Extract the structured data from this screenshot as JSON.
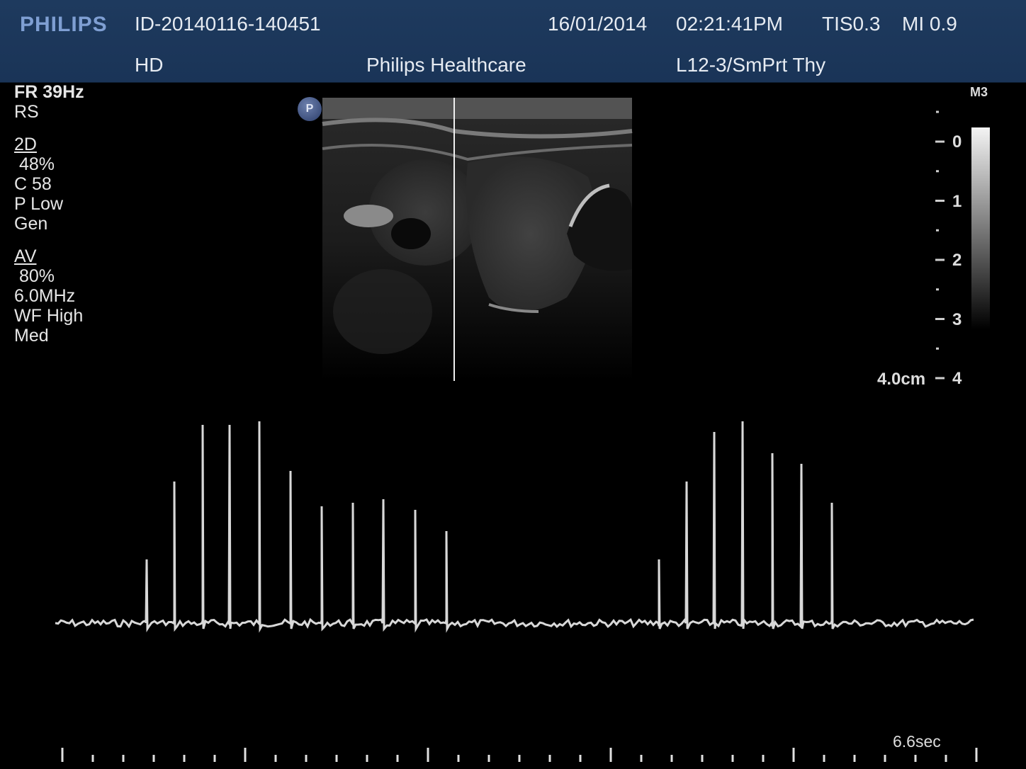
{
  "header": {
    "logo": "PHILIPS",
    "patient_id": "ID-20140116-140451",
    "date": "16/01/2014",
    "time": "02:21:41PM",
    "tis": "TIS0.3",
    "mi": "MI 0.9",
    "mode": "HD",
    "institution": "Philips Healthcare",
    "probe_preset": "L12-3/SmPrt Thy"
  },
  "params": {
    "frame_rate": "FR 39Hz",
    "rs": "RS",
    "section_2d": "2D",
    "gain_2d": " 48%",
    "compression": "C 58",
    "power": "P Low",
    "gen": "Gen",
    "section_av": "AV",
    "gain_av": " 80%",
    "frequency": "6.0MHz",
    "wall_filter": "WF High",
    "med": "Med"
  },
  "right_panel": {
    "map": "M3",
    "depth_labels": [
      "0",
      "1",
      "2",
      "3",
      "4"
    ],
    "depth_total": "4.0cm"
  },
  "image": {
    "probe_badge": "P"
  },
  "trace": {
    "time_scale": "6.6sec"
  },
  "colors": {
    "header_bg": "#1e3a5e",
    "logo": "#7f9fd3",
    "trace": "#d8d8d8"
  }
}
